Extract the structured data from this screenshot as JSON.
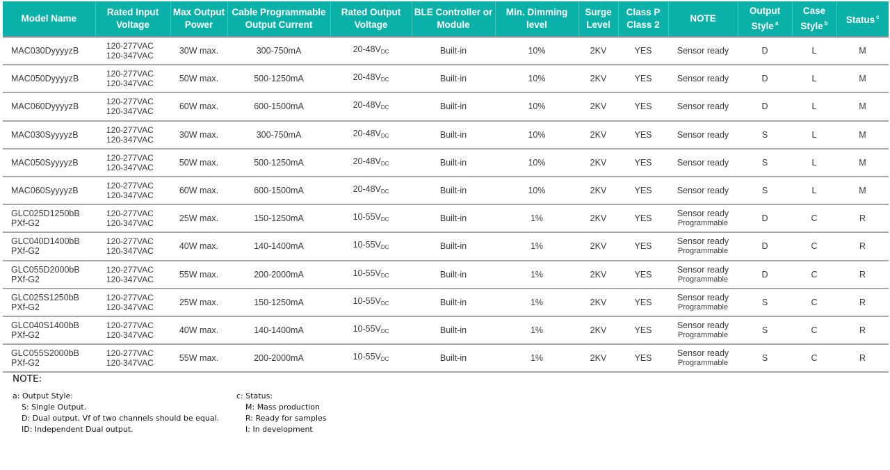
{
  "headers": [
    {
      "label": "Model Name",
      "sup": ""
    },
    {
      "label": "Rated Input Voltage",
      "sup": ""
    },
    {
      "label": "Max Output Power",
      "sup": ""
    },
    {
      "label": "Cable Programmable Output Current",
      "sup": ""
    },
    {
      "label": "Rated Output Voltage",
      "sup": ""
    },
    {
      "label": "BLE Controller or Module",
      "sup": ""
    },
    {
      "label": "Min. Dimming level",
      "sup": ""
    },
    {
      "label": "Surge Level",
      "sup": ""
    },
    {
      "label": "Class P Class 2",
      "sup": ""
    },
    {
      "label": "NOTE",
      "sup": ""
    },
    {
      "label": "Output Style",
      "sup": "a"
    },
    {
      "label": "Case Style",
      "sup": "b"
    },
    {
      "label": "Status",
      "sup": "c"
    }
  ],
  "rows": [
    {
      "model": [
        "MAC030DyyyyzB"
      ],
      "input": [
        "120-277VAC",
        "120-347VAC"
      ],
      "power": "30W max.",
      "current": "300-750mA",
      "vout": "20-48V",
      "vout_sub": "DC",
      "ble": "Built-in",
      "dim": "10%",
      "surge": "2KV",
      "class": "YES",
      "note": "Sensor ready",
      "note2": "",
      "output": "D",
      "case": "L",
      "status": "M"
    },
    {
      "model": [
        "MAC050DyyyyzB"
      ],
      "input": [
        "120-277VAC",
        "120-347VAC"
      ],
      "power": "50W max.",
      "current": "500-1250mA",
      "vout": "20-48V",
      "vout_sub": "DC",
      "ble": "Built-in",
      "dim": "10%",
      "surge": "2KV",
      "class": "YES",
      "note": "Sensor ready",
      "note2": "",
      "output": "D",
      "case": "L",
      "status": "M"
    },
    {
      "model": [
        "MAC060DyyyyzB"
      ],
      "input": [
        "120-277VAC",
        "120-347VAC"
      ],
      "power": "60W max.",
      "current": "600-1500mA",
      "vout": "20-48V",
      "vout_sub": "DC",
      "ble": "Built-in",
      "dim": "10%",
      "surge": "2KV",
      "class": "YES",
      "note": "Sensor ready",
      "note2": "",
      "output": "D",
      "case": "L",
      "status": "M"
    },
    {
      "model": [
        "MAC030SyyyyzB"
      ],
      "input": [
        "120-277VAC",
        "120-347VAC"
      ],
      "power": "30W max.",
      "current": "300-750mA",
      "vout": "20-48V",
      "vout_sub": "DC",
      "ble": "Built-in",
      "dim": "10%",
      "surge": "2KV",
      "class": "YES",
      "note": "Sensor ready",
      "note2": "",
      "output": "S",
      "case": "L",
      "status": "M"
    },
    {
      "model": [
        "MAC050SyyyyzB"
      ],
      "input": [
        "120-277VAC",
        "120-347VAC"
      ],
      "power": "50W max.",
      "current": "500-1250mA",
      "vout": "20-48V",
      "vout_sub": "DC",
      "ble": "Built-in",
      "dim": "10%",
      "surge": "2KV",
      "class": "YES",
      "note": "Sensor ready",
      "note2": "",
      "output": "S",
      "case": "L",
      "status": "M"
    },
    {
      "model": [
        "MAC060SyyyyzB"
      ],
      "input": [
        "120-277VAC",
        "120-347VAC"
      ],
      "power": "60W max.",
      "current": "600-1500mA",
      "vout": "20-48V",
      "vout_sub": "DC",
      "ble": "Built-in",
      "dim": "10%",
      "surge": "2KV",
      "class": "YES",
      "note": "Sensor ready",
      "note2": "",
      "output": "S",
      "case": "L",
      "status": "M"
    },
    {
      "model": [
        "GLC025D1250bB",
        "PXf-G2"
      ],
      "input": [
        "120-277VAC",
        "120-347VAC"
      ],
      "power": "25W max.",
      "current": "150-1250mA",
      "vout": "10-55V",
      "vout_sub": "DC",
      "ble": "Built-in",
      "dim": "1%",
      "surge": "2KV",
      "class": "YES",
      "note": "Sensor ready",
      "note2": "Programmable",
      "output": "D",
      "case": "C",
      "status": "R"
    },
    {
      "model": [
        "GLC040D1400bB",
        "PXf-G2"
      ],
      "input": [
        "120-277VAC",
        "120-347VAC"
      ],
      "power": "40W max.",
      "current": "140-1400mA",
      "vout": "10-55V",
      "vout_sub": "DC",
      "ble": "Built-in",
      "dim": "1%",
      "surge": "2KV",
      "class": "YES",
      "note": "Sensor ready",
      "note2": "Programmable",
      "output": "D",
      "case": "C",
      "status": "R"
    },
    {
      "model": [
        "GLC055D2000bB",
        "PXf-G2"
      ],
      "input": [
        "120-277VAC",
        "120-347VAC"
      ],
      "power": "55W max.",
      "current": "200-2000mA",
      "vout": "10-55V",
      "vout_sub": "DC",
      "ble": "Built-in",
      "dim": "1%",
      "surge": "2KV",
      "class": "YES",
      "note": "Sensor ready",
      "note2": "Programmable",
      "output": "D",
      "case": "C",
      "status": "R"
    },
    {
      "model": [
        "GLC025S1250bB",
        "PXf-G2"
      ],
      "input": [
        "120-277VAC",
        "120-347VAC"
      ],
      "power": "25W max.",
      "current": "150-1250mA",
      "vout": "10-55V",
      "vout_sub": "DC",
      "ble": "Built-in",
      "dim": "1%",
      "surge": "2KV",
      "class": "YES",
      "note": "Sensor ready",
      "note2": "Programmable",
      "output": "S",
      "case": "C",
      "status": "R"
    },
    {
      "model": [
        "GLC040S1400bB",
        "PXf-G2"
      ],
      "input": [
        "120-277VAC",
        "120-347VAC"
      ],
      "power": "40W max.",
      "current": "140-1400mA",
      "vout": "10-55V",
      "vout_sub": "DC",
      "ble": "Built-in",
      "dim": "1%",
      "surge": "2KV",
      "class": "YES",
      "note": "Sensor ready",
      "note2": "Programmable",
      "output": "S",
      "case": "C",
      "status": "R"
    },
    {
      "model": [
        "GLC055S2000bB",
        "PXf-G2"
      ],
      "input": [
        "120-277VAC",
        "120-347VAC"
      ],
      "power": "55W max.",
      "current": "200-2000mA",
      "vout": "10-55V",
      "vout_sub": "DC",
      "ble": "Built-in",
      "dim": "1%",
      "surge": "2KV",
      "class": "YES",
      "note": "Sensor ready",
      "note2": "Programmable",
      "output": "S",
      "case": "C",
      "status": "R"
    }
  ],
  "notes": {
    "title": "NOTE:",
    "output_style": {
      "title": "a: Output Style:",
      "items": [
        "S: Single Output.",
        "D: Dual output, Vf of two channels should be equal.",
        "ID: Independent Dual output."
      ]
    },
    "status": {
      "title": "c: Status:",
      "items": [
        "M: Mass production",
        "R: Ready for samples",
        "I: In development"
      ]
    }
  },
  "colors": {
    "header_bg": "#0ab1a9",
    "header_text": "#ffffff",
    "row_border": "#a8a8a8"
  }
}
